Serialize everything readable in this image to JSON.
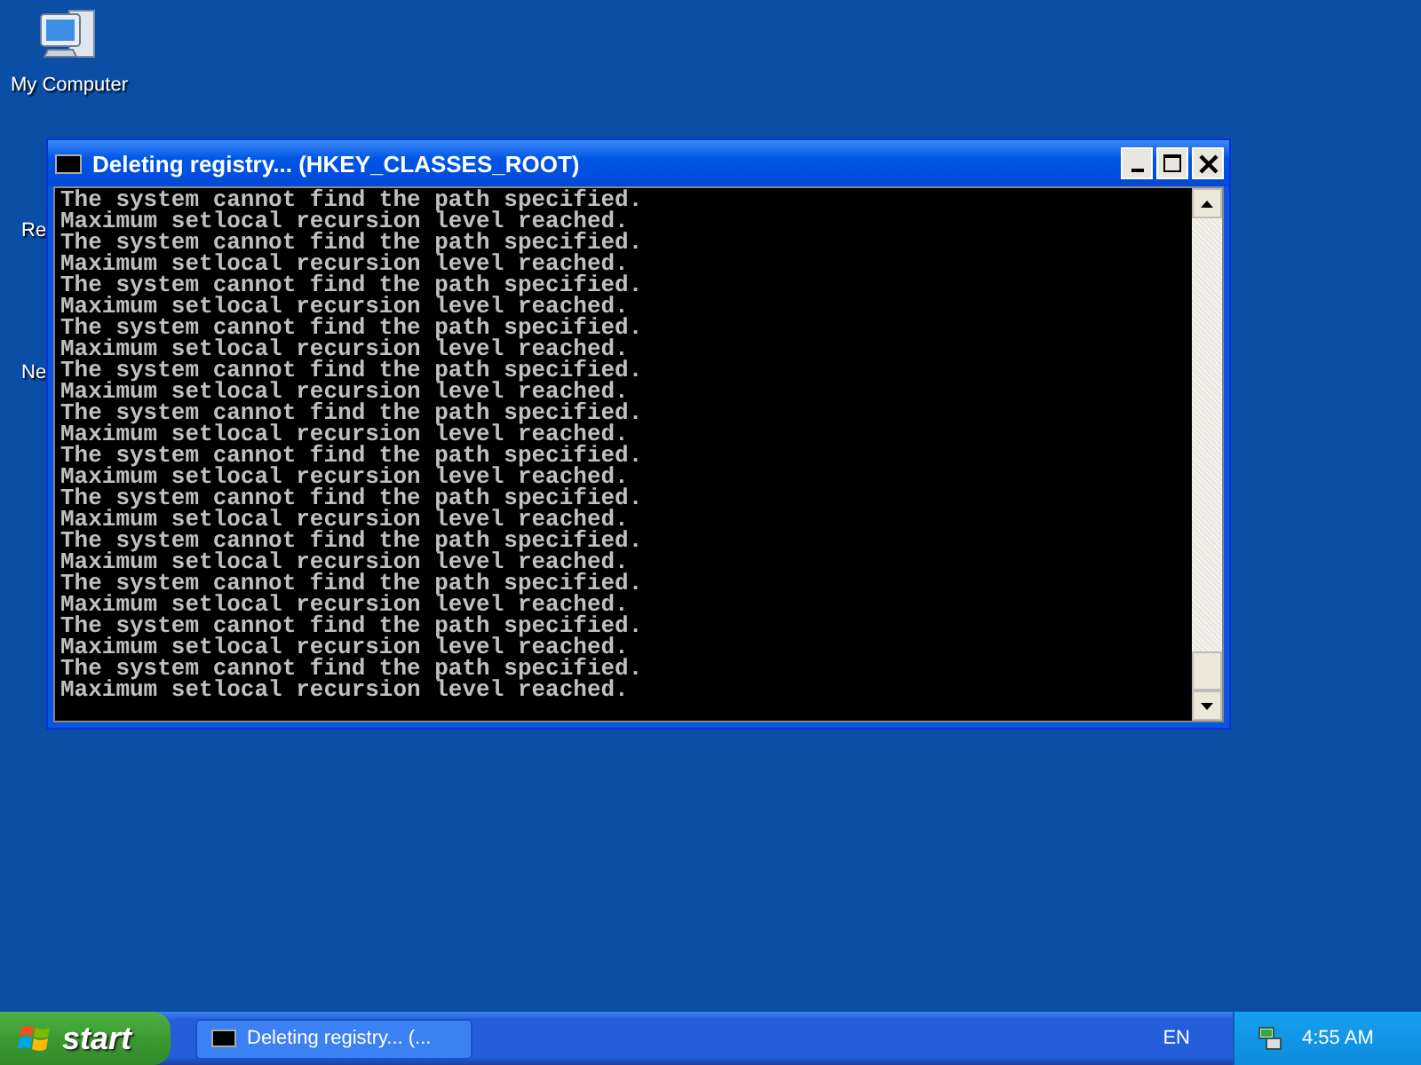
{
  "desktop_icons": [
    {
      "label": "My Computer",
      "kind": "computer"
    },
    {
      "label": "Re",
      "kind": "hidden"
    },
    {
      "label": "Ne",
      "kind": "hidden"
    }
  ],
  "window": {
    "title": "Deleting registry... (HKEY_CLASSES_ROOT)",
    "console_lines": [
      "The system cannot find the path specified.",
      "Maximum setlocal recursion level reached.",
      "The system cannot find the path specified.",
      "Maximum setlocal recursion level reached.",
      "The system cannot find the path specified.",
      "Maximum setlocal recursion level reached.",
      "The system cannot find the path specified.",
      "Maximum setlocal recursion level reached.",
      "The system cannot find the path specified.",
      "Maximum setlocal recursion level reached.",
      "The system cannot find the path specified.",
      "Maximum setlocal recursion level reached.",
      "The system cannot find the path specified.",
      "Maximum setlocal recursion level reached.",
      "The system cannot find the path specified.",
      "Maximum setlocal recursion level reached.",
      "The system cannot find the path specified.",
      "Maximum setlocal recursion level reached.",
      "The system cannot find the path specified.",
      "Maximum setlocal recursion level reached.",
      "The system cannot find the path specified.",
      "Maximum setlocal recursion level reached.",
      "The system cannot find the path specified.",
      "Maximum setlocal recursion level reached."
    ]
  },
  "taskbar": {
    "start_label": "start",
    "tasks": [
      {
        "label": "Deleting registry... (...",
        "selected": false
      }
    ],
    "language": "EN",
    "clock": "4:55 AM"
  }
}
